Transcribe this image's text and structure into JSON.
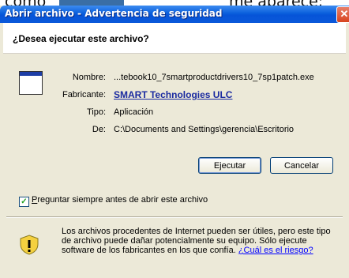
{
  "background": {
    "text_left": "como",
    "text_right": "me aparece:"
  },
  "dialog": {
    "title": "Abrir archivo - Advertencia de seguridad",
    "question": "¿Desea ejecutar este archivo?",
    "fields": {
      "name_label": "Nombre:",
      "name_value": "...tebook10_7smartproductdrivers10_7sp1patch.exe",
      "publisher_label": "Fabricante:",
      "publisher_value": "SMART Technologies ULC",
      "type_label": "Tipo:",
      "type_value": "Aplicación",
      "from_label": "De:",
      "from_value": "C:\\Documents and Settings\\gerencia\\Escritorio"
    },
    "buttons": {
      "run": "Ejecutar",
      "cancel": "Cancelar"
    },
    "checkbox": {
      "label": "Preguntar siempre antes de abrir este archivo",
      "checked": true
    },
    "warning": {
      "text": "Los archivos procedentes de Internet pueden ser útiles, pero este tipo de archivo puede dañar potencialmente su equipo. Sólo ejecute software de los fabricantes en los que confía. ",
      "link": "¿Cuál es el riesgo?"
    },
    "colors": {
      "titlebar": "#0a5fdc",
      "dialog_bg": "#ece9d8",
      "link": "#0000ff",
      "publisher_link": "#1a2aa0",
      "close_button": "#d8431e"
    }
  }
}
